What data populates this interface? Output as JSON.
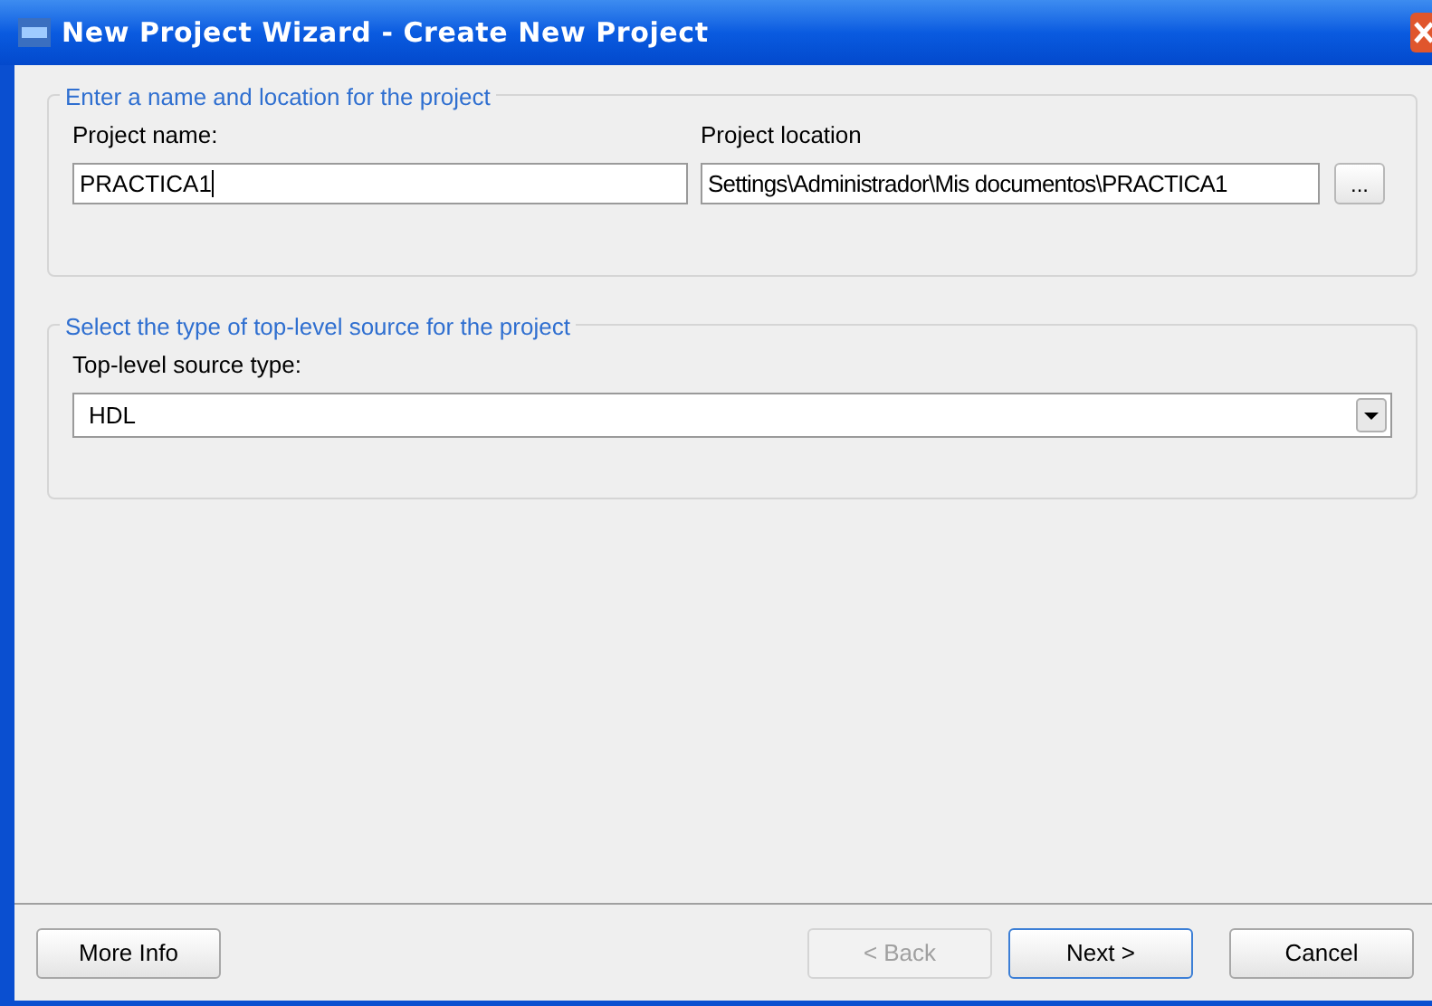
{
  "window": {
    "title": "New Project Wizard - Create New Project"
  },
  "name_group": {
    "legend": "Enter a name and location for the project",
    "name_label": "Project name:",
    "name_value": "PRACTICA1",
    "location_label": "Project location",
    "location_value": "Settings\\Administrador\\Mis documentos\\PRACTICA1",
    "browse_button": "..."
  },
  "source_group": {
    "legend": "Select the type of top-level source for the project",
    "type_label": "Top-level source type:",
    "type_value": "HDL"
  },
  "buttons": [
    {
      "label": "More Info",
      "disabled": false,
      "default": false
    },
    {
      "label": "< Back",
      "disabled": true,
      "default": false
    },
    {
      "label": "Next >",
      "disabled": false,
      "default": true
    },
    {
      "label": "Cancel",
      "disabled": false,
      "default": false
    }
  ]
}
